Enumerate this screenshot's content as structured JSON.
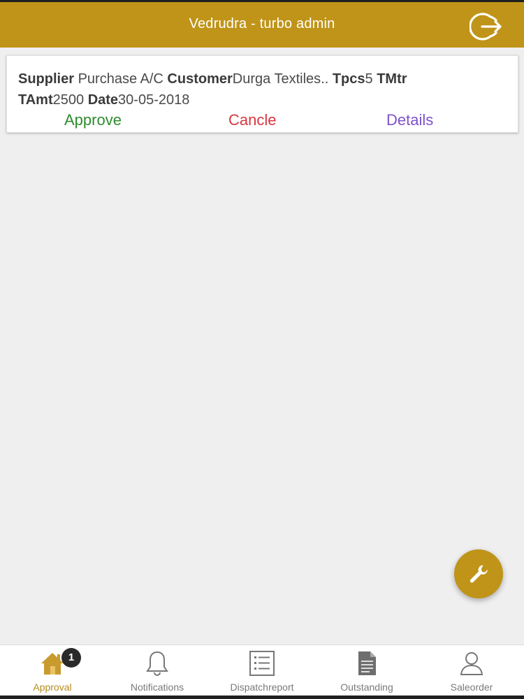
{
  "header": {
    "title": "Vedrudra - turbo admin",
    "logout_icon": "logout-icon"
  },
  "card": {
    "supplier_label": "Supplier",
    "supplier_value": " Purchase A/C ",
    "customer_label": "Customer",
    "customer_value": "Durga Textiles.. ",
    "tpcs_label": "Tpcs",
    "tpcs_value": "5 ",
    "tmtr_label": "TMtr",
    "tamt_label": "TAmt",
    "tamt_value": "2500 ",
    "date_label": "Date",
    "date_value": "30-05-2018",
    "actions": {
      "approve": "Approve",
      "cancel": "Cancle",
      "details": "Details"
    }
  },
  "fab": {
    "icon": "wrench-icon"
  },
  "tabs": [
    {
      "label": "Approval",
      "icon": "home-icon",
      "badge": "1",
      "active": true
    },
    {
      "label": "Notifications",
      "icon": "bell-icon"
    },
    {
      "label": "Dispatchreport",
      "icon": "list-icon"
    },
    {
      "label": "Outstanding",
      "icon": "document-icon"
    },
    {
      "label": "Saleorder",
      "icon": "user-icon"
    }
  ],
  "colors": {
    "accent": "#c09418",
    "approve": "#2e8b2e",
    "cancel": "#d9363e",
    "details": "#7e52c9",
    "background": "#efefef"
  }
}
